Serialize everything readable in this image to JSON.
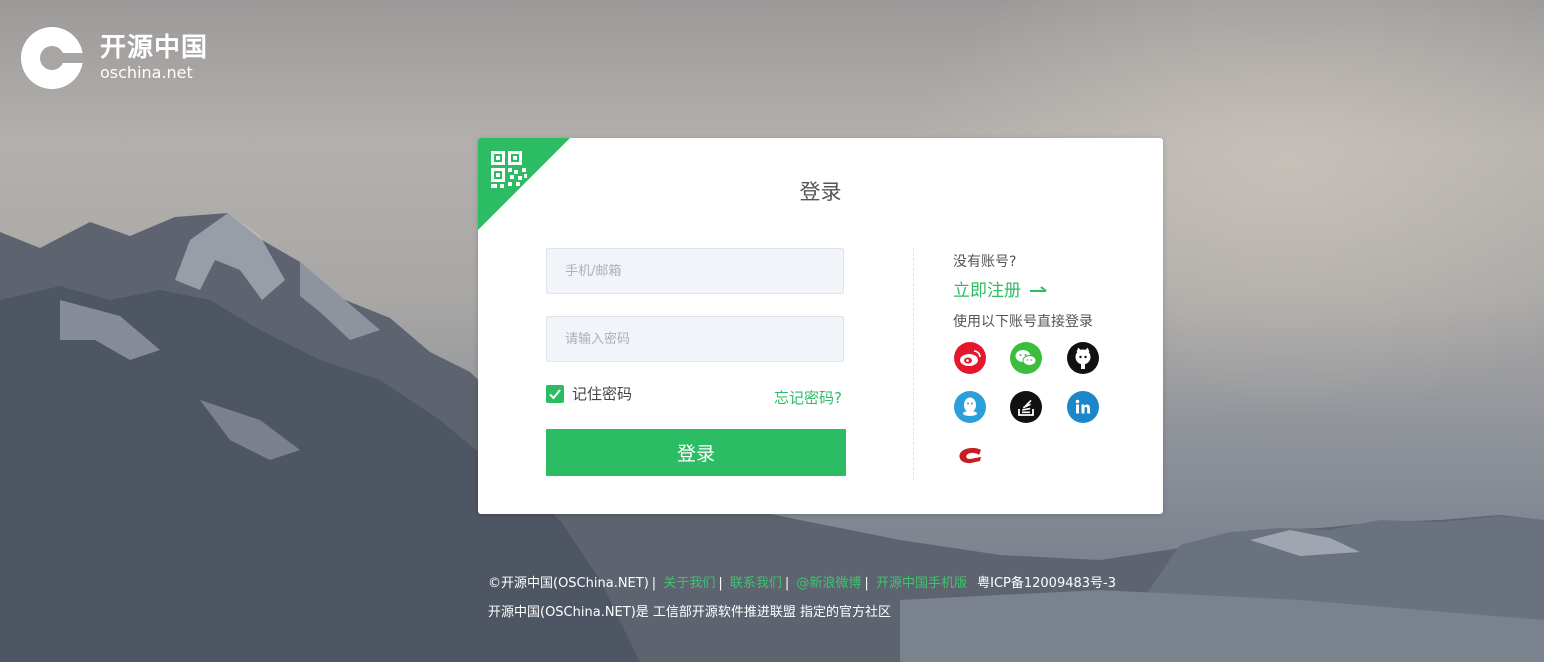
{
  "brand": {
    "name_cn": "开源中国",
    "domain": "oschina.net"
  },
  "login": {
    "title": "登录",
    "qr_icon": "qr-code-icon",
    "account_placeholder": "手机/邮箱",
    "password_placeholder": "请输入密码",
    "remember_label": "记住密码",
    "remember_checked": true,
    "forgot_label": "忘记密码?",
    "submit_label": "登录"
  },
  "signup": {
    "prompt": "没有账号?",
    "register_label": "立即注册",
    "social_label": "使用以下账号直接登录",
    "providers": [
      {
        "icon": "weibo-icon",
        "color": "#e6162d"
      },
      {
        "icon": "wechat-icon",
        "color": "#3cbe3c"
      },
      {
        "icon": "github-icon",
        "color": "#111111"
      },
      {
        "icon": "qq-icon",
        "color": "#2b9fd8"
      },
      {
        "icon": "stackoverflow-icon",
        "color": "#111111"
      },
      {
        "icon": "linkedin-icon",
        "color": "#1b87c9"
      },
      {
        "icon": "gitee-icon",
        "color": "#c71d23"
      }
    ]
  },
  "footer": {
    "copyright": "©开源中国(OSChina.NET)",
    "links": [
      "关于我们",
      "联系我们",
      "@新浪微博",
      "开源中国手机版"
    ],
    "icp": "粤ICP备12009483号-3",
    "statement": "开源中国(OSChina.NET)是 工信部开源软件推进联盟 指定的官方社区"
  },
  "colors": {
    "accent": "#2cbc64",
    "card_bg": "#ffffff"
  }
}
